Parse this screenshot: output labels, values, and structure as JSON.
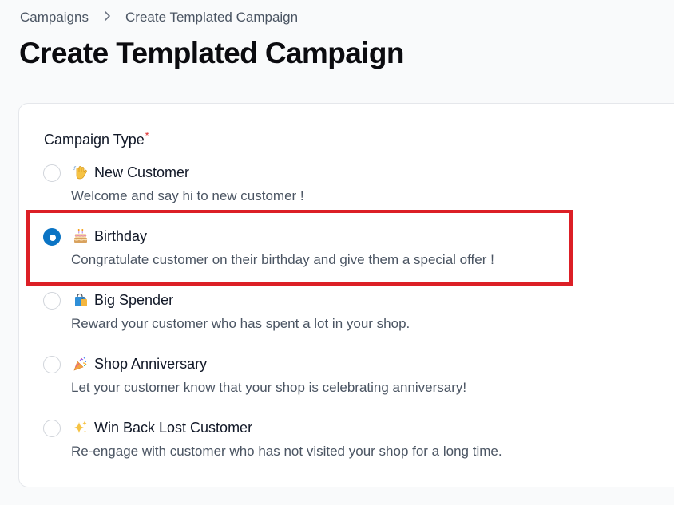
{
  "breadcrumb": {
    "parent": "Campaigns",
    "separator": ">",
    "current": "Create Templated Campaign"
  },
  "page": {
    "title": "Create Templated Campaign"
  },
  "form": {
    "campaign_type_label": "Campaign Type",
    "required_marker": "*",
    "selected": "birthday",
    "options": [
      {
        "id": "new-customer",
        "emoji": "👋",
        "title": "New Customer",
        "description": "Welcome and say hi to new customer !",
        "checked": false
      },
      {
        "id": "birthday",
        "emoji": "🎂",
        "title": "Birthday",
        "description": "Congratulate customer on their birthday and give them a special offer !",
        "checked": true
      },
      {
        "id": "big-spender",
        "emoji": "🛍️",
        "title": "Big Spender",
        "description": "Reward your customer who has spent a lot in your shop.",
        "checked": false
      },
      {
        "id": "shop-anniversary",
        "emoji": "🎉",
        "title": "Shop Anniversary",
        "description": "Let your customer know that your shop is celebrating anniversary!",
        "checked": false
      },
      {
        "id": "win-back",
        "emoji": "✨",
        "title": "Win Back Lost Customer",
        "description": "Re-engage with customer who has not visited your shop for a long time.",
        "checked": false
      }
    ]
  },
  "colors": {
    "accent": "#0b74c4",
    "highlight": "#dc1f26",
    "required": "#dc2626"
  }
}
